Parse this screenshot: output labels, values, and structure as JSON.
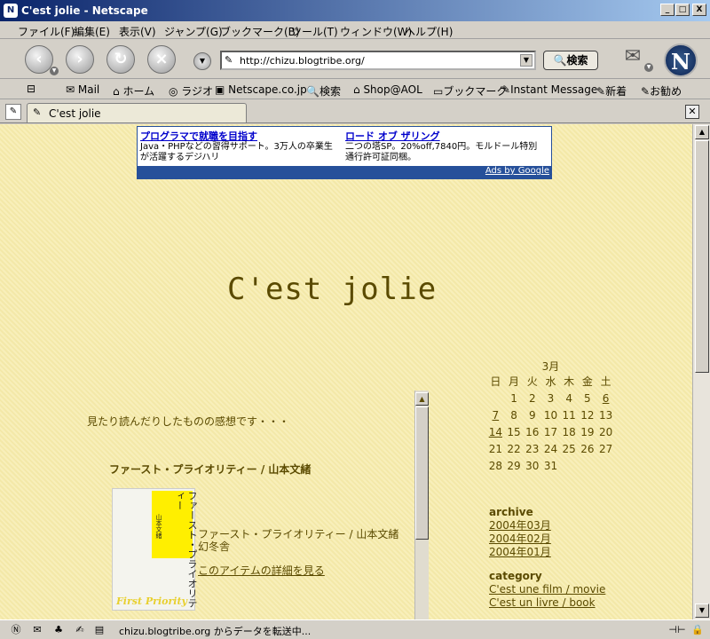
{
  "window": {
    "title": "C'est jolie - Netscape",
    "minimize": "_",
    "maximize": "□",
    "close": "X"
  },
  "menu": {
    "items": [
      "ファイル(F)",
      "編集(E)",
      "表示(V)",
      "ジャンプ(G)",
      "ブックマーク(B)",
      "ツール(T)",
      "ウィンドウ(W)",
      "ヘルプ(H)"
    ]
  },
  "nav": {
    "url": "http://chizu.blogtribe.org/",
    "search_label": "検索"
  },
  "bookmarks": {
    "items": [
      "Mail",
      "ホーム",
      "ラジオ",
      "Netscape.co.jp",
      "検索",
      "Shop@AOL",
      "ブックマーク",
      "Instant Message",
      "新着",
      "お勧め"
    ]
  },
  "tab": {
    "label": "C'est jolie"
  },
  "ad": {
    "ad1_title": "プログラマで就職を目指す",
    "ad1_line1": "Java・PHPなどの習得サポート。3万人の卒業生",
    "ad1_line2": "が活躍するデジハリ",
    "ad2_title": "ロード オブ ザリング",
    "ad2_line1": "二つの塔SP。20%off,7840円。モルドール特別",
    "ad2_line2": "通行許可証同梱。",
    "footer": "Ads by Google"
  },
  "page": {
    "site_title": "C'est jolie",
    "intro": "見たり読んだりしたものの感想です・・・",
    "post_title": "ファースト・プライオリティー / 山本文緒",
    "book_cover_title": "ファースト・プライオリティー",
    "book_cover_author": "山本文緒",
    "book_cover_en": "First Priority",
    "book_info_title": "ファースト・プライオリティー / 山本文緒",
    "book_info_publisher": "幻冬舎",
    "book_detail_link": "このアイテムの詳細を見る"
  },
  "calendar": {
    "month": "3月",
    "weekdays": [
      "日",
      "月",
      "火",
      "水",
      "木",
      "金",
      "土"
    ],
    "weeks": [
      [
        "",
        "1",
        "2",
        "3",
        "4",
        "5",
        "6"
      ],
      [
        "7",
        "8",
        "9",
        "10",
        "11",
        "12",
        "13"
      ],
      [
        "14",
        "15",
        "16",
        "17",
        "18",
        "19",
        "20"
      ],
      [
        "21",
        "22",
        "23",
        "24",
        "25",
        "26",
        "27"
      ],
      [
        "28",
        "29",
        "30",
        "31",
        "",
        "",
        ""
      ]
    ],
    "linked_days": [
      "6",
      "7",
      "14"
    ]
  },
  "archive": {
    "heading": "archive",
    "items": [
      "2004年03月",
      "2004年02月",
      "2004年01月"
    ]
  },
  "category": {
    "heading": "category",
    "items": [
      "C'est une film / movie",
      "C'est un livre / book"
    ]
  },
  "status": {
    "text": "chizu.blogtribe.org からデータを転送中..."
  }
}
